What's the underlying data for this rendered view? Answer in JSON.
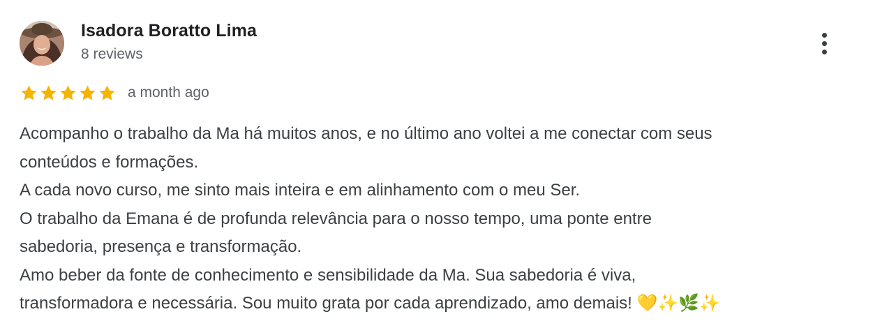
{
  "review": {
    "author_name": "Isadora Boratto Lima",
    "review_count": "8 reviews",
    "rating": 5,
    "rating_max": 5,
    "date": "a month ago",
    "text_lines": [
      "Acompanho o trabalho da Ma há muitos anos, e no último ano voltei a me conectar com seus",
      "conteúdos e formações.",
      "A cada novo curso, me sinto mais inteira e em alinhamento com o meu Ser.",
      "O trabalho da Emana é de profunda relevância para o nosso tempo, uma ponte entre",
      "sabedoria, presença e transformação.",
      "Amo beber da fonte de conhecimento e sensibilidade da Ma. Sua sabedoria é viva,",
      "transformadora e necessária. Sou muito grata por cada aprendizado, amo demais! 💛✨🌿✨"
    ]
  },
  "icons": {
    "avatar": "user-avatar-photo",
    "star": "star-icon",
    "menu": "more-vertical-icon"
  },
  "colors": {
    "star": "#f4b400",
    "name": "#202124",
    "secondary_text": "#5f6368",
    "body_text": "#3c4043"
  }
}
